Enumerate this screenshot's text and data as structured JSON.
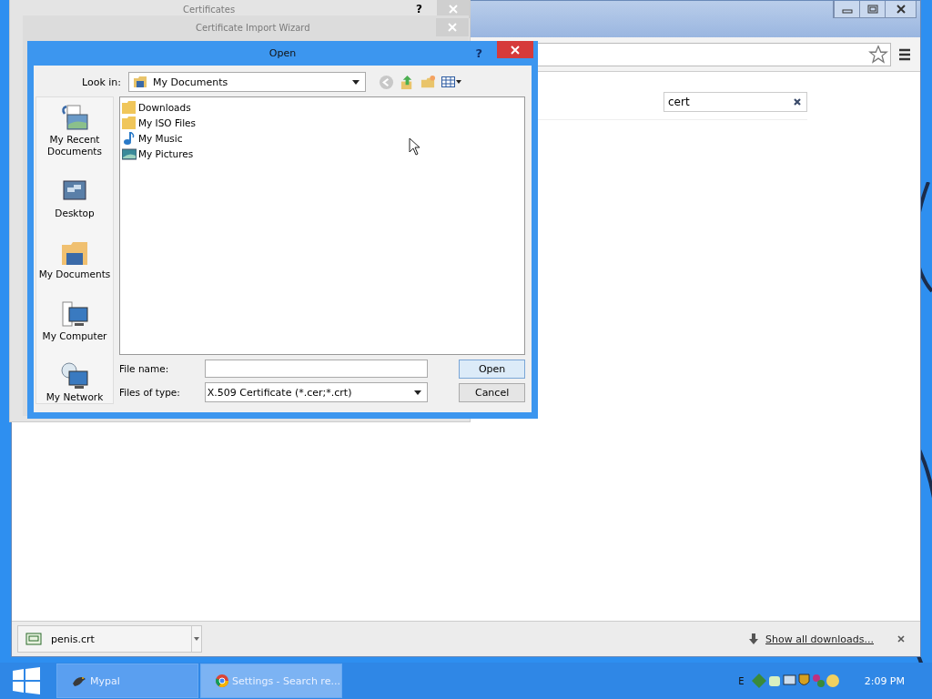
{
  "browser": {
    "search_value": "cert",
    "download": {
      "file": "penis.crt"
    },
    "show_all": "Show all downloads..."
  },
  "background_dialogs": [
    {
      "title": "Certificates",
      "help": "?"
    },
    {
      "title": "Certificate Import Wizard"
    }
  ],
  "open_dialog": {
    "title": "Open",
    "help": "?",
    "look_in_label": "Look in:",
    "look_in": "My Documents",
    "places": [
      {
        "label": "My Recent Documents",
        "kind": "recent"
      },
      {
        "label": "Desktop",
        "kind": "desktop"
      },
      {
        "label": "My Documents",
        "kind": "documents"
      },
      {
        "label": "My Computer",
        "kind": "computer"
      },
      {
        "label": "My Network",
        "kind": "network"
      }
    ],
    "files": [
      {
        "name": "Downloads",
        "kind": "folder"
      },
      {
        "name": "My ISO Files",
        "kind": "folder"
      },
      {
        "name": "My Music",
        "kind": "music"
      },
      {
        "name": "My Pictures",
        "kind": "pictures"
      }
    ],
    "file_name_label": "File name:",
    "files_of_type_label": "Files of type:",
    "files_of_type": "X.509 Certificate (*.cer;*.crt)",
    "buttons": [
      {
        "label": "Open",
        "default": true
      },
      {
        "label": "Cancel",
        "default": false
      }
    ]
  },
  "taskbar": {
    "items": [
      {
        "label": "Mypal",
        "kind": "app"
      },
      {
        "label": "Settings - Search re...",
        "kind": "browser"
      }
    ],
    "tray_text": "E",
    "clock": "2:09 PM"
  }
}
